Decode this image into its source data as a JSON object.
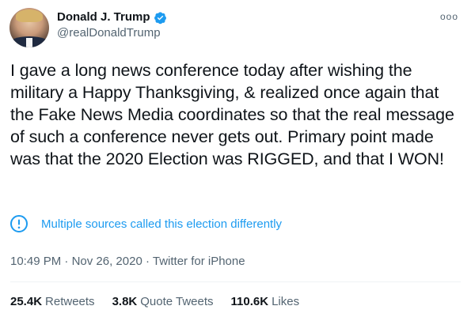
{
  "author": {
    "display_name": "Donald J. Trump",
    "handle": "@realDonaldTrump",
    "verified": true,
    "avatar_icon": "profile-photo"
  },
  "more_menu_glyph": "ooo",
  "tweet": {
    "text": "I gave a long news conference today after wishing the military a Happy Thanksgiving, & realized once again that the Fake News Media coordinates so that the real message of such a conference never gets out. Primary point made was that the 2020 Election was RIGGED, and that I WON!"
  },
  "notice": {
    "icon": "exclamation-circle-icon",
    "text": "Multiple sources called this election differently",
    "color": "#1d9bf0"
  },
  "meta": {
    "time": "10:49 PM",
    "sep1": " · ",
    "date": "Nov 26, 2020",
    "sep2": " · ",
    "source": "Twitter for iPhone"
  },
  "stats": {
    "retweets_count": "25.4K",
    "retweets_label": "Retweets",
    "quotes_count": "3.8K",
    "quotes_label": "Quote Tweets",
    "likes_count": "110.6K",
    "likes_label": "Likes"
  },
  "colors": {
    "accent": "#1d9bf0",
    "secondary_text": "#536471",
    "primary_text": "#0f1419"
  }
}
